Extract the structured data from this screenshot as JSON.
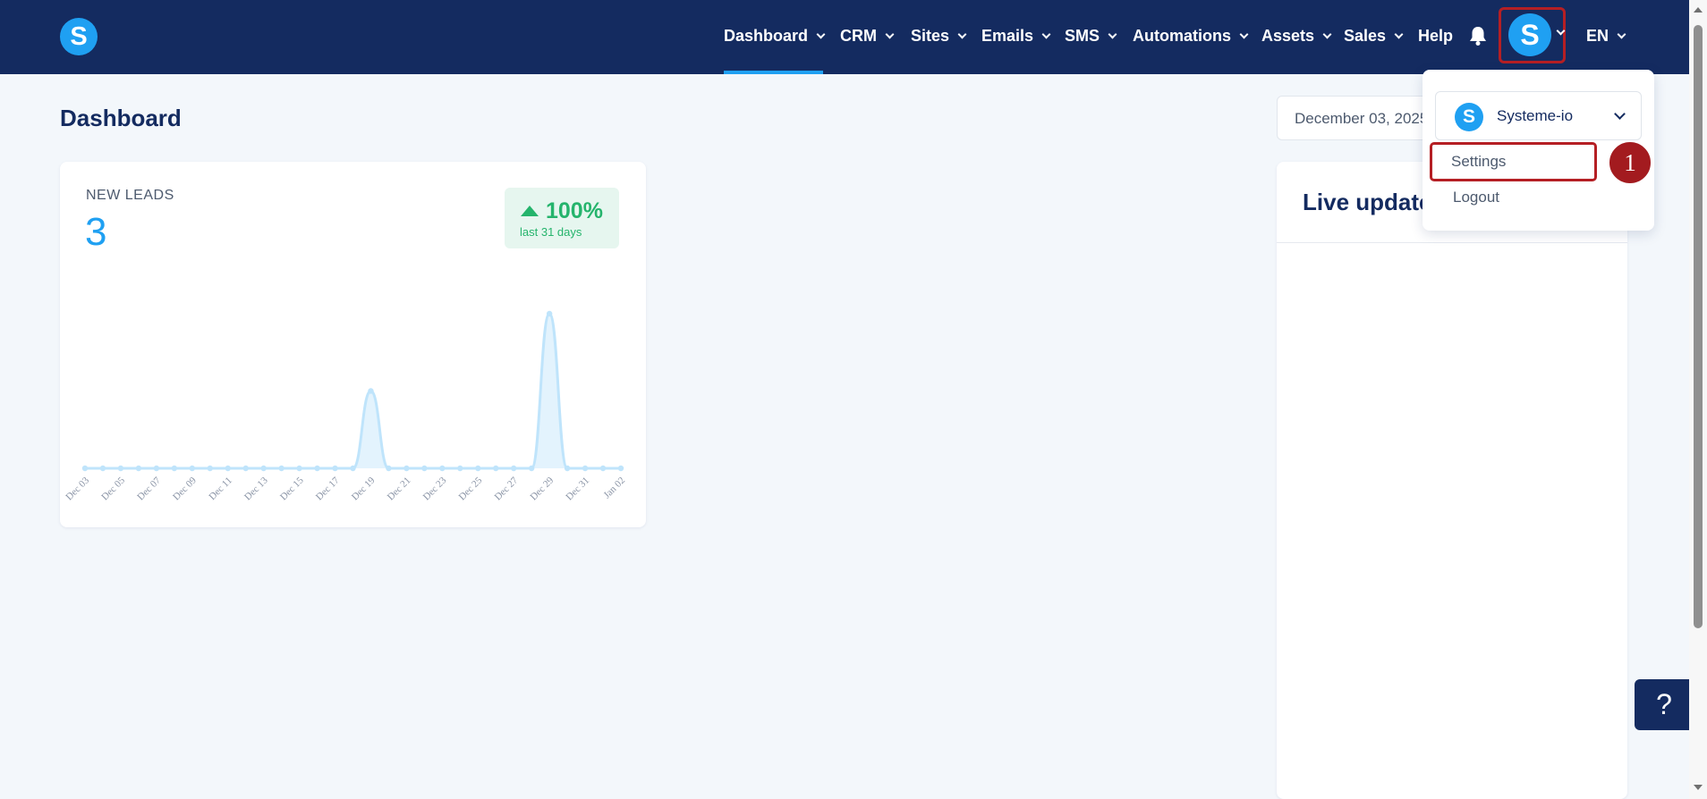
{
  "brand": {
    "logo_letter": "S",
    "accent_color": "#1fa0f2",
    "navbar_color": "#142b60"
  },
  "nav": {
    "items": [
      {
        "label": "Dashboard",
        "has_dropdown": true,
        "active": true
      },
      {
        "label": "CRM",
        "has_dropdown": true
      },
      {
        "label": "Sites",
        "has_dropdown": true
      },
      {
        "label": "Emails",
        "has_dropdown": true
      },
      {
        "label": "SMS",
        "has_dropdown": true
      },
      {
        "label": "Automations",
        "has_dropdown": true
      },
      {
        "label": "Assets",
        "has_dropdown": true
      },
      {
        "label": "Sales",
        "has_dropdown": true
      },
      {
        "label": "Help",
        "has_dropdown": false
      }
    ],
    "notification_icon": "bell-icon",
    "avatar_letter": "S",
    "language": "EN"
  },
  "page": {
    "title": "Dashboard",
    "date_range": "December 03, 2025"
  },
  "new_leads": {
    "label": "NEW LEADS",
    "value": "3",
    "change_pct": "100%",
    "change_period": "last 31 days",
    "change_direction": "up",
    "change_color": "#25b46c"
  },
  "chart_data": {
    "type": "area",
    "x": [
      "Dec 03",
      "Dec 04",
      "Dec 05",
      "Dec 06",
      "Dec 07",
      "Dec 08",
      "Dec 09",
      "Dec 10",
      "Dec 11",
      "Dec 12",
      "Dec 13",
      "Dec 14",
      "Dec 15",
      "Dec 16",
      "Dec 17",
      "Dec 18",
      "Dec 19",
      "Dec 20",
      "Dec 21",
      "Dec 22",
      "Dec 23",
      "Dec 24",
      "Dec 25",
      "Dec 26",
      "Dec 27",
      "Dec 28",
      "Dec 29",
      "Dec 30",
      "Dec 31",
      "Jan 01",
      "Jan 02"
    ],
    "tick_labels": [
      "Dec 03",
      "Dec 05",
      "Dec 07",
      "Dec 09",
      "Dec 11",
      "Dec 13",
      "Dec 15",
      "Dec 17",
      "Dec 19",
      "Dec 21",
      "Dec 23",
      "Dec 25",
      "Dec 27",
      "Dec 29",
      "Dec 31",
      "Jan 02"
    ],
    "series": [
      {
        "values": [
          0,
          0,
          0,
          0,
          0,
          0,
          0,
          0,
          0,
          0,
          0,
          0,
          0,
          0,
          0,
          0,
          1,
          0,
          0,
          0,
          0,
          0,
          0,
          0,
          0,
          0,
          2,
          0,
          0,
          0,
          0
        ]
      }
    ],
    "ylim": [
      0,
      2
    ],
    "grid": false,
    "color": "#1fa0f2"
  },
  "live_updates": {
    "title": "Live updates"
  },
  "account_menu": {
    "account_name": "Systeme-io",
    "account_logo_letter": "S",
    "items": [
      {
        "label": "Settings",
        "highlighted": true
      },
      {
        "label": "Logout"
      }
    ],
    "step_marker": "1"
  },
  "help_button": {
    "label": "?"
  }
}
